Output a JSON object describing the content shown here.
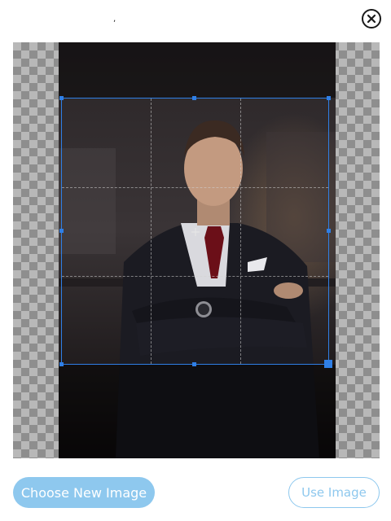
{
  "header": {
    "tick_mark": ",",
    "close_icon": "close-circle-icon"
  },
  "editor": {
    "photo_subject": "portrait-man-in-suit",
    "crop_handle_icon": "resize-handle-icon",
    "accent_color": "#2f7fe6"
  },
  "actions": {
    "choose_label": "Choose New Image",
    "use_label": "Use Image",
    "button_color": "#8ec8ee"
  }
}
